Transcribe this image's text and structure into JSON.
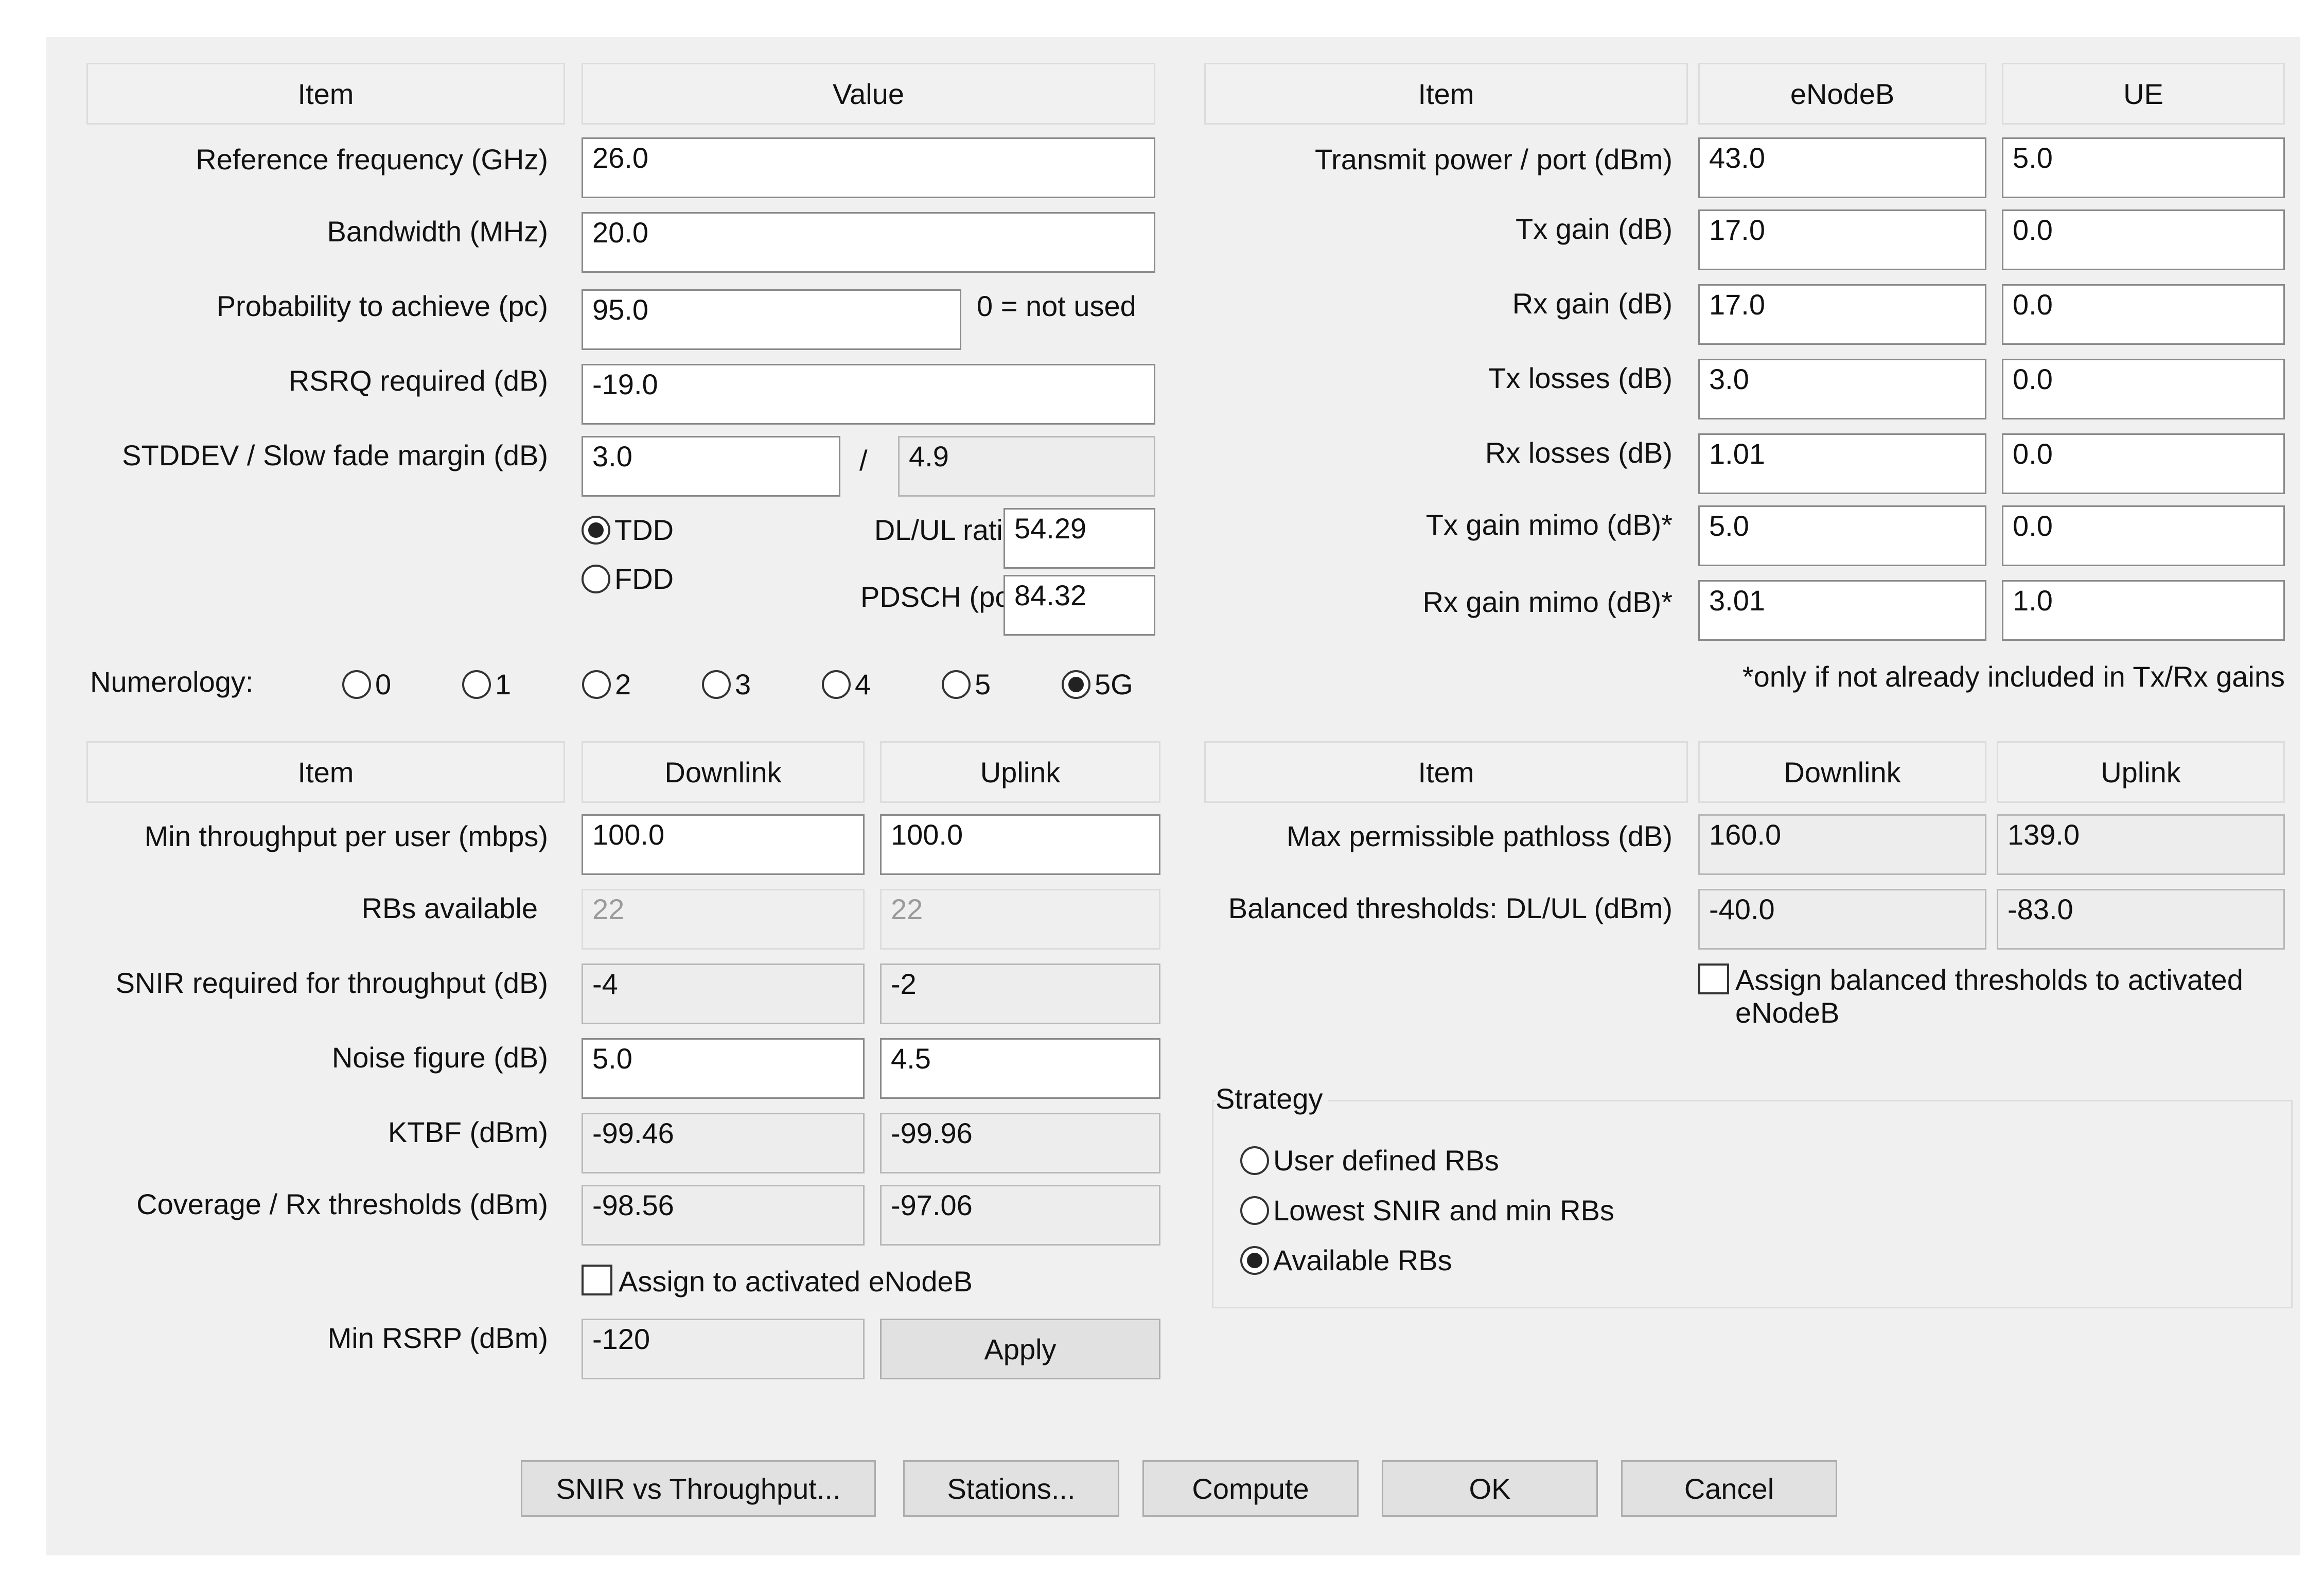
{
  "general": {
    "header_item": "Item",
    "header_value": "Value",
    "ref_freq_label": "Reference frequency (GHz)",
    "ref_freq_value": "26.0",
    "bandwidth_label": "Bandwidth (MHz)",
    "bandwidth_value": "20.0",
    "probability_label": "Probability to achieve (pc)",
    "probability_value": "95.0",
    "probability_note": "0 = not used",
    "rsrq_label": "RSRQ required (dB)",
    "rsrq_value": "-19.0",
    "stddev_label": "STDDEV / Slow fade margin (dB)",
    "stddev_value": "3.0",
    "stddev_sep": "/",
    "slow_fade_value": "4.9"
  },
  "duplex": {
    "tdd_label": "TDD",
    "fdd_label": "FDD",
    "dlul_label": "DL/UL ratio",
    "dlul_value": "54.29",
    "pdsch_label": "PDSCH (pc)",
    "pdsch_value": "84.32"
  },
  "numerology": {
    "label": "Numerology:",
    "options": [
      "0",
      "1",
      "2",
      "3",
      "4",
      "5",
      "5G"
    ],
    "selected": "5G"
  },
  "link_table": {
    "header_item": "Item",
    "header_downlink": "Downlink",
    "header_uplink": "Uplink",
    "min_tp_label": "Min throughput per user (mbps)",
    "min_tp_dl": "100.0",
    "min_tp_ul": "100.0",
    "rbs_label": "RBs available",
    "rbs_dl": "22",
    "rbs_ul": "22",
    "snir_label": "SNIR required for throughput (dB)",
    "snir_dl": "-4",
    "snir_ul": "-2",
    "nf_label": "Noise figure (dB)",
    "nf_dl": "5.0",
    "nf_ul": "4.5",
    "ktbf_label": "KTBF (dBm)",
    "ktbf_dl": "-99.46",
    "ktbf_ul": "-99.96",
    "cov_label": "Coverage / Rx thresholds (dBm)",
    "cov_dl": "-98.56",
    "cov_ul": "-97.06",
    "assign_label": "Assign to activated eNodeB",
    "min_rsrp_label": "Min RSRP (dBm)",
    "min_rsrp_value": "-120",
    "apply_label": "Apply"
  },
  "radio_table": {
    "header_item": "Item",
    "header_enb": "eNodeB",
    "header_ue": "UE",
    "rows": [
      {
        "label": "Transmit power / port (dBm)",
        "enb": "43.0",
        "ue": "5.0"
      },
      {
        "label": "Tx gain (dB)",
        "enb": "17.0",
        "ue": "0.0"
      },
      {
        "label": "Rx gain (dB)",
        "enb": "17.0",
        "ue": "0.0"
      },
      {
        "label": "Tx losses (dB)",
        "enb": "3.0",
        "ue": "0.0"
      },
      {
        "label": "Rx losses (dB)",
        "enb": "1.01",
        "ue": "0.0"
      },
      {
        "label": "Tx gain mimo (dB)*",
        "enb": "5.0",
        "ue": "0.0"
      },
      {
        "label": "Rx gain mimo (dB)*",
        "enb": "3.01",
        "ue": "1.0"
      }
    ],
    "footnote": "*only if not already included in Tx/Rx gains"
  },
  "pathloss_table": {
    "header_item": "Item",
    "header_downlink": "Downlink",
    "header_uplink": "Uplink",
    "mpl_label": "Max permissible pathloss (dB)",
    "mpl_dl": "160.0",
    "mpl_ul": "139.0",
    "bal_label": "Balanced thresholds: DL/UL (dBm)",
    "bal_dl": "-40.0",
    "bal_ul": "-83.0",
    "assign_bal_label": "Assign balanced thresholds to activated eNodeB"
  },
  "strategy": {
    "title": "Strategy",
    "options": [
      "User defined RBs",
      "Lowest SNIR and min RBs",
      "Available RBs"
    ],
    "selected": "Available RBs"
  },
  "buttons": {
    "snir_tp": "SNIR vs Throughput...",
    "stations": "Stations...",
    "compute": "Compute",
    "ok": "OK",
    "cancel": "Cancel"
  }
}
